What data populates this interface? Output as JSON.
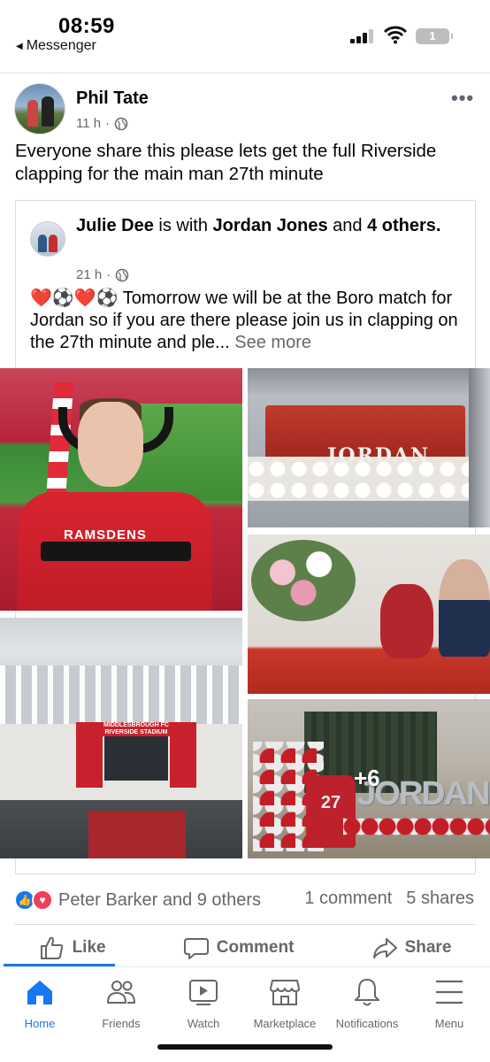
{
  "status_bar": {
    "time": "08:59",
    "back_label": "Messenger",
    "battery": "1"
  },
  "post": {
    "author": "Phil Tate",
    "time_ago": "11 h",
    "privacy_icon": "globe-icon",
    "text": "Everyone share this please lets get the full Riverside clapping for the main man 27th minute"
  },
  "shared_post": {
    "author": "Julie Dee",
    "is_with": "is with",
    "tagged": "Jordan Jones",
    "and": "and",
    "others": "4 others.",
    "time_ago": "21 h",
    "text": "❤️⚽❤️⚽ Tomorrow we will be at the Boro match for Jordan so if you are there please join us in clapping on the 27th minute and ple...",
    "see_more": "See more",
    "photos": {
      "shirt_text": "RAMSDENS",
      "wreath_text": "JORDAN",
      "stadium_sign": "MIDDLESBROUGH FC RIVERSIDE STADIUM",
      "jersey_number": "27",
      "letters_text": "JORDAN",
      "more_count": "+6"
    }
  },
  "engagement": {
    "reactions_text": "Peter Barker and 9 others",
    "comments": "1 comment",
    "shares": "5 shares"
  },
  "actions": {
    "like": "Like",
    "comment": "Comment",
    "share": "Share"
  },
  "tabs": [
    {
      "label": "Home",
      "icon": "home-icon"
    },
    {
      "label": "Friends",
      "icon": "friends-icon"
    },
    {
      "label": "Watch",
      "icon": "watch-icon"
    },
    {
      "label": "Marketplace",
      "icon": "marketplace-icon"
    },
    {
      "label": "Notifications",
      "icon": "bell-icon"
    },
    {
      "label": "Menu",
      "icon": "menu-icon"
    }
  ],
  "colors": {
    "accent": "#1877f2",
    "love": "#f33e58",
    "secondary_text": "#65676b"
  }
}
